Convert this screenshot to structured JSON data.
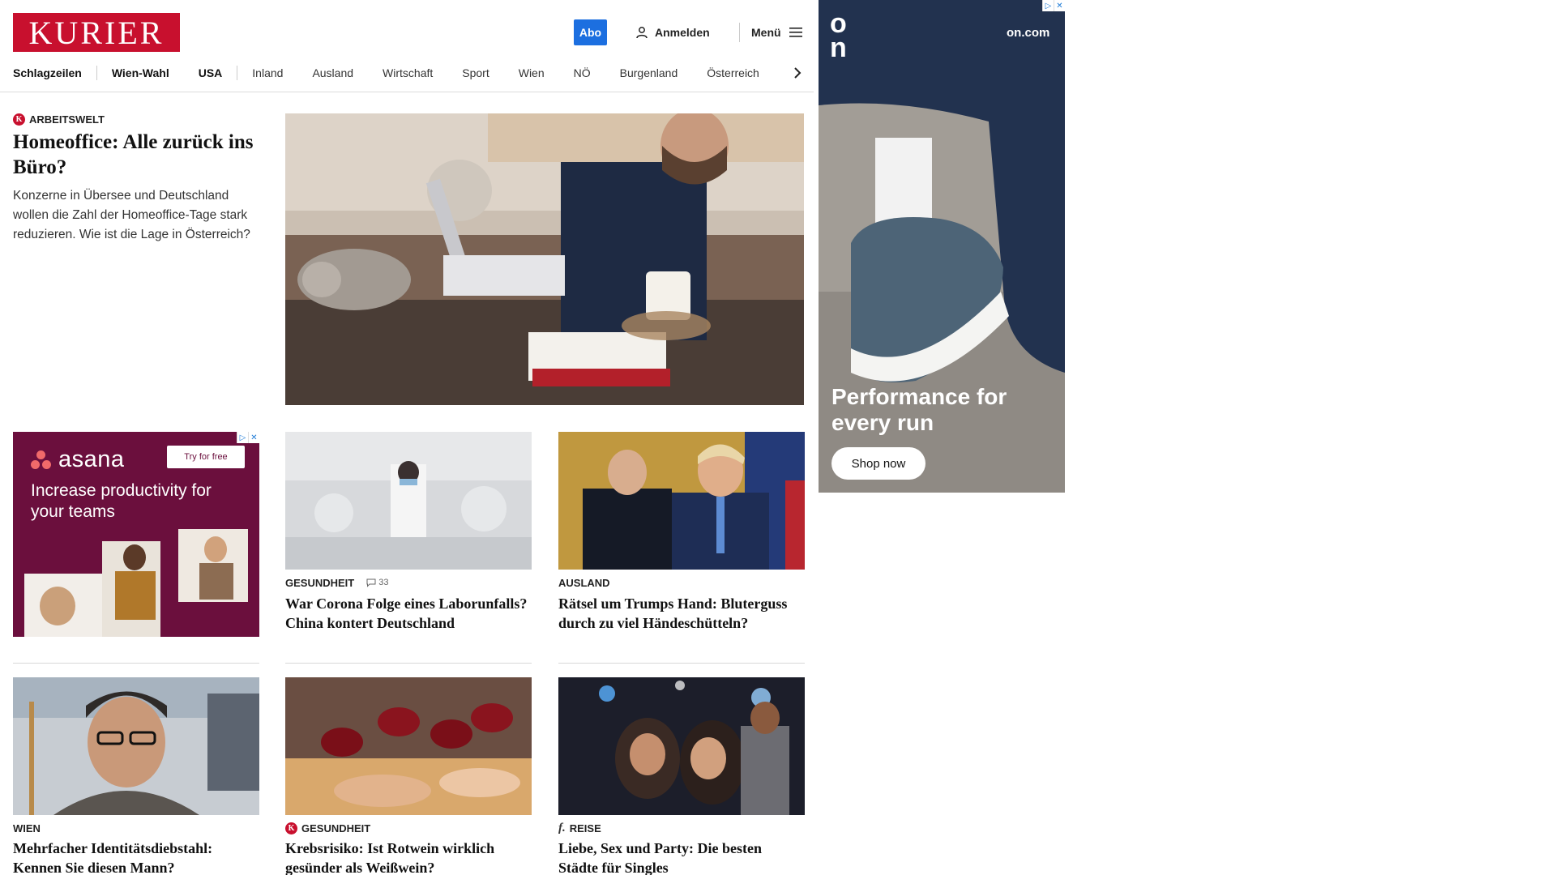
{
  "header": {
    "logo": "KURIER",
    "abo_label": "Abo",
    "login_label": "Anmelden",
    "menu_label": "Menü"
  },
  "nav": {
    "items": [
      "Schlagzeilen",
      "Wien-Wahl",
      "USA",
      "Inland",
      "Ausland",
      "Wirtschaft",
      "Sport",
      "Wien",
      "NÖ",
      "Burgenland",
      "Österreich"
    ]
  },
  "lead": {
    "kicker": "ARBEITSWELT",
    "title": "Homeoffice: Alle zurück ins Büro?",
    "teaser": "Konzerne in Übersee und Deutschland wollen die Zahl der Homeoffice-Tage stark reduzieren. Wie ist die Lage in Österreich?"
  },
  "cards": [
    {
      "kicker": "GESUNDHEIT",
      "comments": "33",
      "title": "War Corona Folge eines Laborunfalls? China kontert Deutschland"
    },
    {
      "kicker": "AUSLAND",
      "title": "Rätsel um Trumps Hand: Bluterguss durch zu viel Händeschütteln?"
    },
    {
      "kicker": "WIEN",
      "title": "Mehrfacher Identitätsdiebstahl: Kennen Sie diesen Mann?"
    },
    {
      "kicker": "GESUNDHEIT",
      "title": "Krebsrisiko: Ist Rotwein wirklich gesünder als Weißwein?"
    },
    {
      "kicker": "REISE",
      "title": "Liebe, Sex und Party: Die besten Städte für Singles"
    }
  ],
  "ads": {
    "asana": {
      "brand": "asana",
      "cta": "Try for free",
      "headline": "Increase productivity for your teams"
    },
    "on": {
      "logo": "on",
      "url": "on.com",
      "headline": "Performance for every run",
      "cta": "Shop now"
    }
  },
  "colors": {
    "brand_red": "#c8102e",
    "abo_blue": "#1c6fe0",
    "asana_bg": "#6b0f3d",
    "asana_coral": "#f06a6a"
  }
}
